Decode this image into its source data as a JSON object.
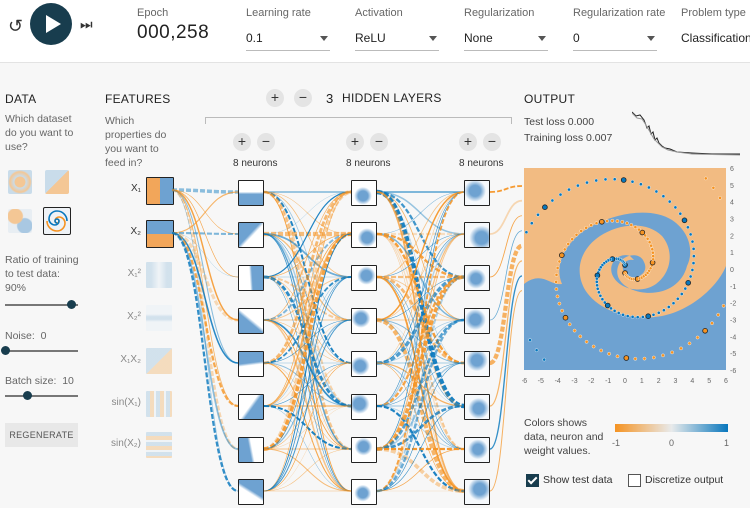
{
  "topbar": {
    "epoch_label": "Epoch",
    "epoch_value": "000,258",
    "params": [
      {
        "label": "Learning rate",
        "value": "0.1"
      },
      {
        "label": "Activation",
        "value": "ReLU"
      },
      {
        "label": "Regularization",
        "value": "None"
      },
      {
        "label": "Regularization rate",
        "value": "0"
      },
      {
        "label": "Problem type",
        "value": "Classification"
      }
    ]
  },
  "data_panel": {
    "title": "DATA",
    "question": "Which dataset do you want to use?",
    "selected_dataset": "spiral",
    "ratio_label": "Ratio of training to test data:",
    "ratio_value": "90%",
    "ratio": 0.9,
    "noise_label": "Noise:",
    "noise_value": "0",
    "noise": 0,
    "batch_label": "Batch size:",
    "batch_value": "10",
    "batch": 0.3,
    "regenerate_label": "REGENERATE"
  },
  "features": {
    "title": "FEATURES",
    "question": "Which properties do you want to feed in?",
    "items": [
      {
        "label": "X₁",
        "active": true
      },
      {
        "label": "X₂",
        "active": true
      },
      {
        "label": "X₁²",
        "active": false
      },
      {
        "label": "X₂²",
        "active": false
      },
      {
        "label": "X₁X₂",
        "active": false
      },
      {
        "label": "sin(X₁)",
        "active": false
      },
      {
        "label": "sin(X₂)",
        "active": false
      }
    ]
  },
  "network": {
    "hidden_count": "3",
    "hidden_label": "HIDDEN LAYERS",
    "plus": "+",
    "minus": "−",
    "layers": [
      {
        "neurons_label": "8 neurons"
      },
      {
        "neurons_label": "8 neurons"
      },
      {
        "neurons_label": "8 neurons"
      }
    ]
  },
  "output": {
    "title": "OUTPUT",
    "test_loss": "Test loss 0.000",
    "training_loss": "Training loss 0.007",
    "x_ticks": [
      "-6",
      "-5",
      "-4",
      "-3",
      "-2",
      "-1",
      "0",
      "1",
      "2",
      "3",
      "4",
      "5",
      "6"
    ],
    "y_ticks": [
      "6",
      "5",
      "4",
      "3",
      "2",
      "1",
      "0",
      "-1",
      "-2",
      "-3",
      "-4",
      "-5",
      "-6"
    ],
    "legend_text": "Colors shows data, neuron and weight values.",
    "legend_ticks": [
      "-1",
      "0",
      "1"
    ],
    "show_test_label": "Show test data",
    "show_test_checked": true,
    "discretize_label": "Discretize output",
    "discretize_checked": false
  },
  "colors": {
    "orange": "#f59322",
    "blue": "#0877bd",
    "dark_blue": "#183d4e",
    "orange_bg": "#f2bb82",
    "blue_bg": "#6ea2d1"
  }
}
